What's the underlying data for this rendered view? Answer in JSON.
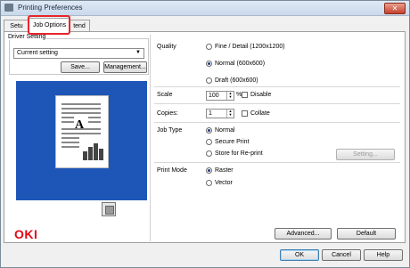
{
  "window": {
    "title": "Printing Preferences",
    "close_glyph": "✕"
  },
  "tabs": [
    {
      "label": "Setu"
    },
    {
      "label": "Job Options"
    },
    {
      "label": "tend"
    }
  ],
  "driver_setting": {
    "label": "Driver Setting",
    "selected": "Current setting",
    "save_label": "Save...",
    "management_label": "Management..."
  },
  "preview": {
    "letter": "A"
  },
  "quality": {
    "label": "Quality",
    "options": [
      "Fine / Detail (1200x1200)",
      "Normal (600x600)",
      "Draft (600x600)"
    ],
    "selected_index": 1
  },
  "scale": {
    "label": "Scale",
    "value": "100",
    "unit": "%",
    "disable_label": "Disable"
  },
  "copies": {
    "label": "Copies:",
    "value": "1",
    "collate_label": "Collate"
  },
  "job_type": {
    "label": "Job Type",
    "options": [
      "Normal",
      "Secure Print",
      "Store for Re-print"
    ],
    "selected_index": 0,
    "setting_label": "Setting..."
  },
  "print_mode": {
    "label": "Print Mode",
    "options": [
      "Raster",
      "Vector"
    ],
    "selected_index": 0
  },
  "footer": {
    "brand": "OKI",
    "advanced_label": "Advanced...",
    "default_label": "Default",
    "ok_label": "OK",
    "cancel_label": "Cancel",
    "help_label": "Help"
  },
  "icons": {
    "app": "printer-icon",
    "tray": "paper-tray-icon",
    "close": "close-icon",
    "dropdown": "chevron-down-icon"
  },
  "colors": {
    "preview_bg": "#1e56b8",
    "highlight": "#e8242b",
    "brand": "#e30613"
  }
}
